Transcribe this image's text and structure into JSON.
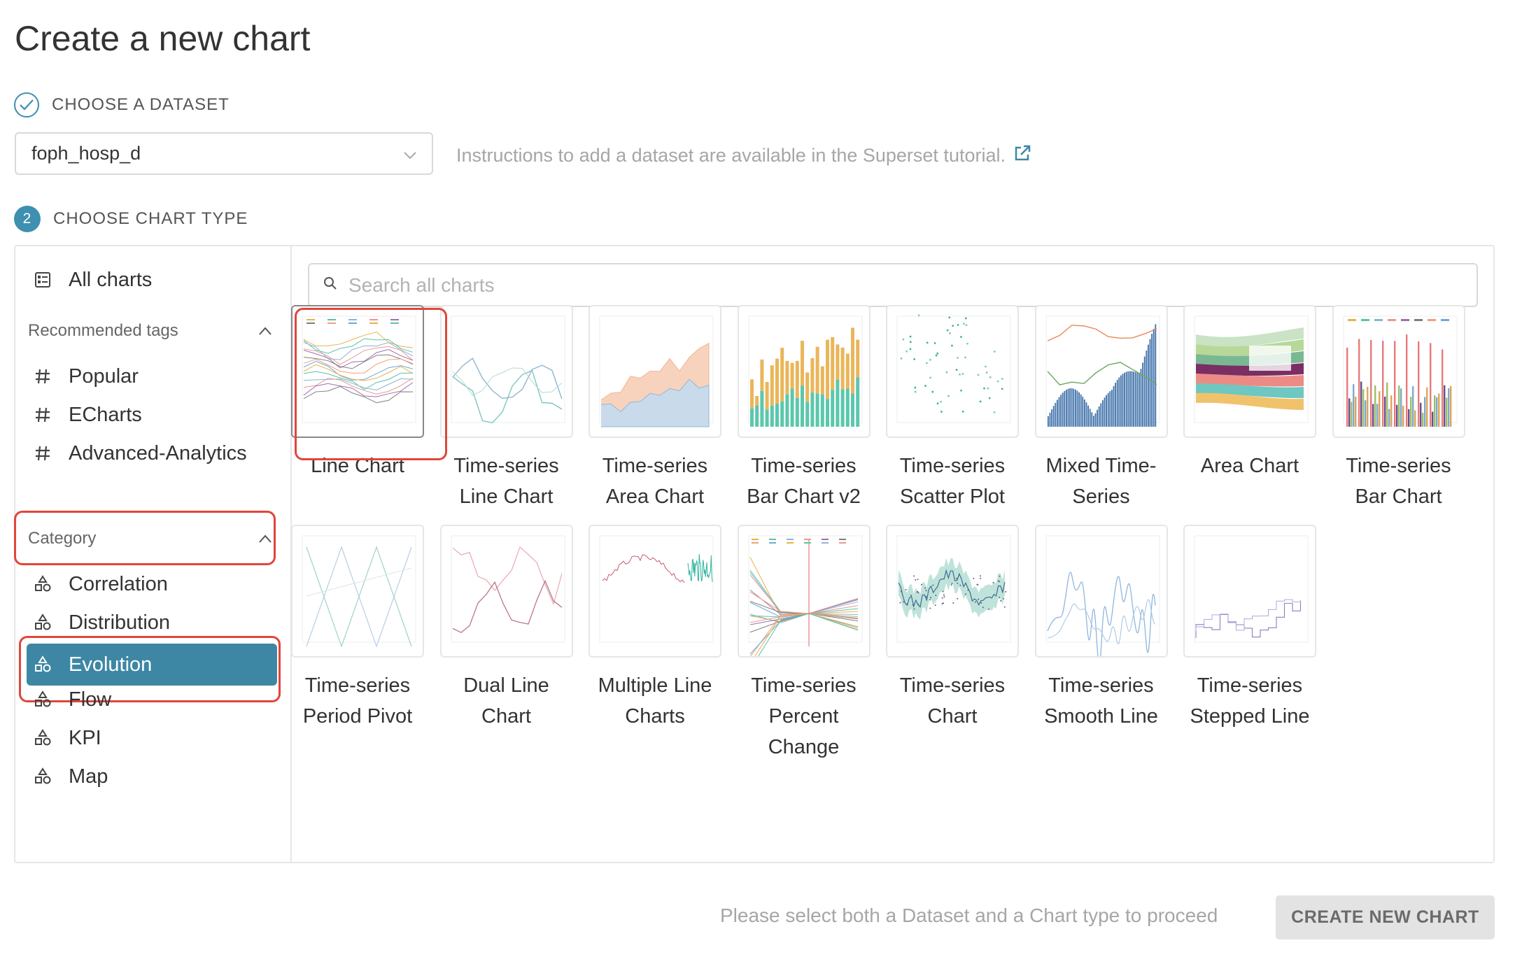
{
  "page": {
    "title": "Create a new chart"
  },
  "step1": {
    "label": "CHOOSE A DATASET",
    "icon": "check-icon",
    "dataset_value": "foph_hosp_d",
    "hint": "Instructions to add a dataset are available in the Superset tutorial.",
    "hint_icon": "external-link-icon"
  },
  "step2": {
    "number": "2",
    "label": "CHOOSE CHART TYPE"
  },
  "sidebar": {
    "all_charts": "All charts",
    "recommended_header": "Recommended tags",
    "tags": [
      "Popular",
      "ECharts",
      "Advanced-Analytics"
    ],
    "category_header": "Category",
    "categories": [
      "Correlation",
      "Distribution",
      "Evolution",
      "Flow",
      "KPI",
      "Map"
    ],
    "selected_category": "Evolution"
  },
  "search": {
    "placeholder": "Search all charts"
  },
  "charts": [
    {
      "label": "Line Chart",
      "selected": true,
      "thumb": "multiline"
    },
    {
      "label": "Time-series Line Chart",
      "thumb": "ts-line"
    },
    {
      "label": "Time-series Area Chart",
      "thumb": "area"
    },
    {
      "label": "Time-series Bar Chart v2",
      "thumb": "bar-stacked"
    },
    {
      "label": "Time-series Scatter Plot",
      "thumb": "scatter"
    },
    {
      "label": "Mixed Time-Series",
      "thumb": "mixed"
    },
    {
      "label": "Area Chart",
      "thumb": "stream"
    },
    {
      "label": "Time-series Bar Chart",
      "thumb": "bar-multi"
    },
    {
      "label": "Time-series Period Pivot",
      "thumb": "pivot"
    },
    {
      "label": "Dual Line Chart",
      "thumb": "dual"
    },
    {
      "label": "Multiple Line Charts",
      "thumb": "multi-small"
    },
    {
      "label": "Time-series Percent Change",
      "thumb": "percent"
    },
    {
      "label": "Time-series Chart",
      "thumb": "band"
    },
    {
      "label": "Time-series Smooth Line",
      "thumb": "smooth"
    },
    {
      "label": "Time-series Stepped Line",
      "thumb": "stepped"
    }
  ],
  "footer": {
    "message": "Please select both a Dataset and a Chart type to proceed",
    "button": "CREATE NEW CHART"
  },
  "colors": {
    "accent": "#3d87a5",
    "highlight": "#e0463a"
  }
}
